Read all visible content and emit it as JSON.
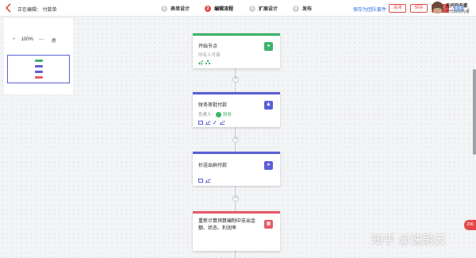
{
  "header": {
    "editing_title": "正在编辑： 付款单",
    "steps": [
      {
        "num": "1",
        "label": "表单设计"
      },
      {
        "num": "2",
        "label": "编辑流程"
      },
      {
        "num": "3",
        "label": "扩展设计"
      },
      {
        "num": "4",
        "label": "发布"
      }
    ],
    "active_step": 2,
    "save_template_link": "保存为团队套件",
    "close_label": "关闭",
    "save_label": "保存",
    "publish_label": "发布",
    "more_label": "更多",
    "user_name": "无代码专家",
    "user_subtitle": "无代码领先者"
  },
  "canvas_tools": {
    "zoom_in": "+",
    "zoom_value": "100%",
    "zoom_out": "—",
    "reset_icon_label": "总"
  },
  "nodes": [
    {
      "title": "开始节点",
      "subtitle": "所有人可填",
      "color": "#3bb36a"
    },
    {
      "title": "财务审批付款",
      "owner_label": "负责人:",
      "owner_name": "财务",
      "color": "#5b5fd6"
    },
    {
      "title": "抄送出纳付款",
      "color": "#5b5fd6"
    },
    {
      "title": "重新计算预算编制中支出金额、状态、利润率",
      "color": "#e45b66"
    }
  ],
  "side_badge": "206",
  "watermark": "知乎 @速融云",
  "colors": {
    "accent": "#e24a4a",
    "green": "#3bb36a",
    "purple": "#5b5fd6",
    "link": "#2f6fe0"
  }
}
